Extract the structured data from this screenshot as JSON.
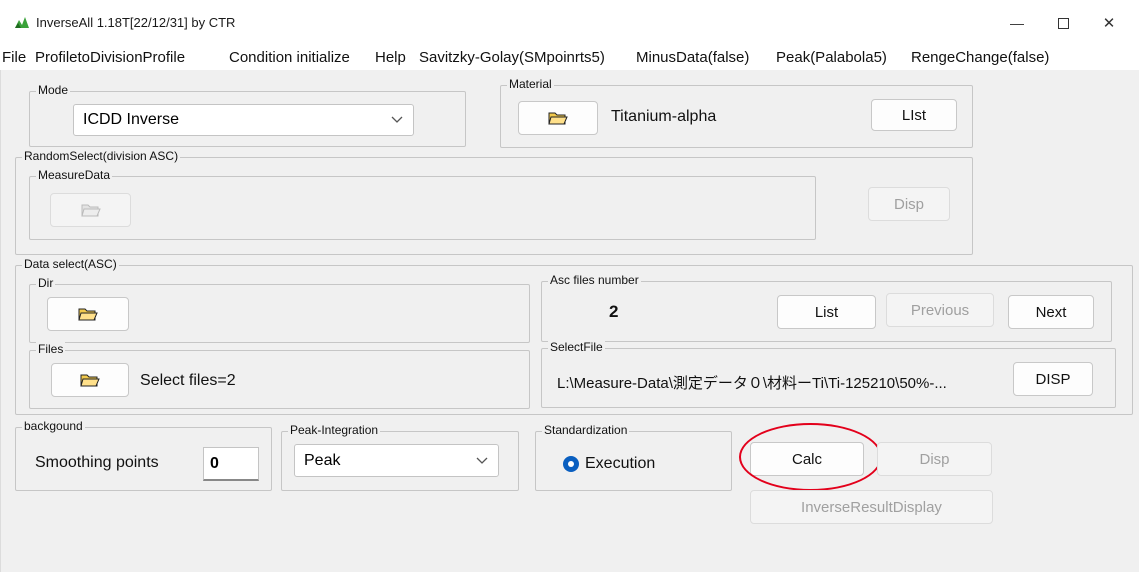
{
  "window": {
    "title": "InverseAll 1.18T[22/12/31] by CTR",
    "minimize_label": "—",
    "close_label": "✕"
  },
  "menu": [
    "File",
    "ProfiletoDivisionProfile",
    "Condition initialize",
    "Help",
    "Savitzky-Golay(SMpoinrts5)",
    "MinusData(false)",
    "Peak(Palabola5)",
    "RengeChange(false)"
  ],
  "mode": {
    "label": "Mode",
    "selected": "ICDD Inverse"
  },
  "material": {
    "label": "Material",
    "name": "Titanium-alpha",
    "list_button": "LIst"
  },
  "random_select": {
    "label": "RandomSelect(division ASC)",
    "measure_data_label": "MeasureData",
    "disp_button": "Disp"
  },
  "data_select": {
    "label": "Data select(ASC)",
    "dir_label": "Dir",
    "files_label": "Files",
    "files_text": "Select files=2",
    "asc_label": "Asc files number",
    "asc_count": "2",
    "list_button": "List",
    "previous_button": "Previous",
    "next_button": "Next",
    "select_file_label": "SelectFile",
    "select_file_path": "L:\\Measure-Data\\測定データ０\\材料ーTi\\Ti-125210\\50%-...",
    "disp_button": "DISP"
  },
  "background": {
    "label": "backgound",
    "smoothing_label": "Smoothing points",
    "smoothing_value": "0"
  },
  "peak_integration": {
    "label": "Peak-Integration",
    "selected": "Peak"
  },
  "standardization": {
    "label": "Standardization",
    "option": "Execution"
  },
  "actions": {
    "calc_button": "Calc",
    "disp_button": "Disp",
    "inverse_result_button": "InverseResultDisplay"
  },
  "colors": {
    "annotation_circle": "#e3001b",
    "radio_accent": "#0a5fc0",
    "folder_yellow": "#f2c94c"
  }
}
